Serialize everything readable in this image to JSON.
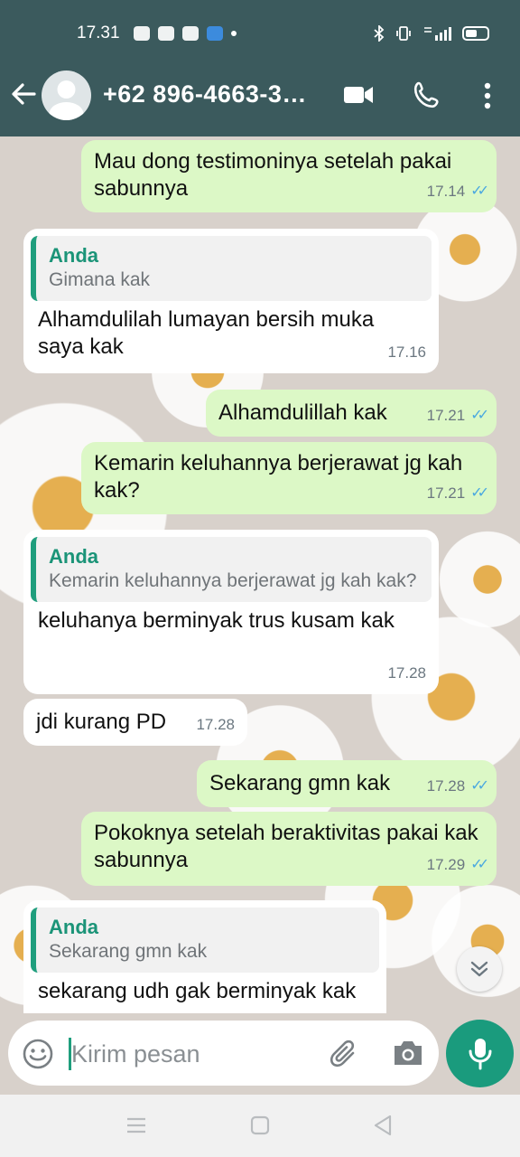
{
  "status_bar": {
    "time": "17.31"
  },
  "header": {
    "contact": "+62 896-4663-3…"
  },
  "messages": [
    {
      "text": "Mau dong testimoninya setelah pakai sabunnya",
      "time": "17.14"
    },
    {
      "quote_name": "Anda",
      "quote_text": "Gimana kak",
      "text": "Alhamdulilah lumayan bersih muka saya kak",
      "time": "17.16"
    },
    {
      "text": "Alhamdulillah kak",
      "time": "17.21"
    },
    {
      "text": "Kemarin keluhannya berjerawat jg kah kak?",
      "time": "17.21"
    },
    {
      "quote_name": "Anda",
      "quote_text": "Kemarin keluhannya berjerawat jg kah kak?",
      "text": "keluhanya berminyak trus kusam kak",
      "time": "17.28"
    },
    {
      "text": "jdi kurang PD",
      "time": "17.28"
    },
    {
      "text": "Sekarang gmn kak",
      "time": "17.28"
    },
    {
      "text": "Pokoknya setelah beraktivitas pakai kak sabunnya",
      "time": "17.29"
    },
    {
      "quote_name": "Anda",
      "quote_text": "Sekarang gmn kak",
      "text": "sekarang udh gak berminyak kak"
    }
  ],
  "composer": {
    "placeholder": "Kirim pesan"
  },
  "colors": {
    "header": "#3b5a5d",
    "outgoing": "#dcf8c6",
    "incoming": "#ffffff",
    "accent": "#1a9b7d",
    "read_ticks": "#4aa8e0"
  }
}
